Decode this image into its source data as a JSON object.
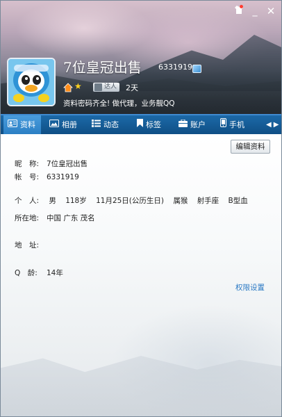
{
  "window": {
    "controls": {
      "skin": "shirt-icon",
      "minimize": "_",
      "close": "✕"
    }
  },
  "profile": {
    "display_name": "7位皇冠出售",
    "qq_number": "6331919",
    "level_tag": "达人",
    "days": "2天",
    "signature": "资料密码齐全! 做代理，业务靓QQ"
  },
  "tabs": [
    {
      "label": "资料",
      "icon": "profile-card-icon",
      "active": true
    },
    {
      "label": "相册",
      "icon": "photo-album-icon"
    },
    {
      "label": "动态",
      "icon": "feed-list-icon"
    },
    {
      "label": "标签",
      "icon": "bookmark-tag-icon"
    },
    {
      "label": "账户",
      "icon": "wallet-icon"
    },
    {
      "label": "手机",
      "icon": "phone-icon"
    }
  ],
  "tab_arrows": {
    "left": "◀",
    "right": "▶"
  },
  "content": {
    "edit_button": "编辑资料",
    "nickname": {
      "label": "昵　称:",
      "value": "7位皇冠出售"
    },
    "account": {
      "label": "帐　号:",
      "value": "6331919"
    },
    "personal": {
      "label": "个　人:",
      "gender": "男",
      "age": "118岁",
      "birthday": "11月25日(公历生日)",
      "zodiac": "属猴",
      "constellation": "射手座",
      "blood": "B型血"
    },
    "location": {
      "label": "所在地:",
      "value": "中国 广东 茂名"
    },
    "address": {
      "label": "地　址:",
      "value": ""
    },
    "q_age": {
      "label": "Q　龄:",
      "value": "14年"
    },
    "permission_link": "权限设置"
  },
  "colors": {
    "tab_bar": "#0f4f85",
    "tab_active": "#2b7fc4",
    "link": "#2a79c4"
  }
}
